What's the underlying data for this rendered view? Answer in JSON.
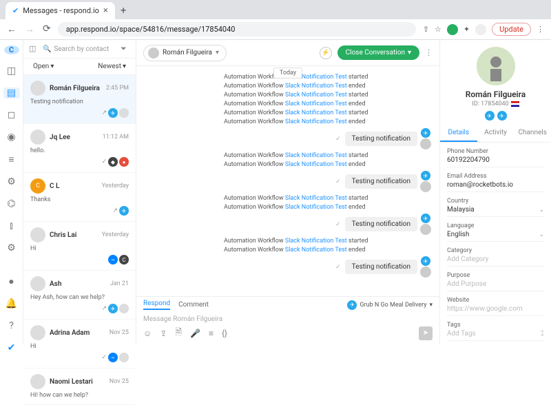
{
  "browser": {
    "tab_title": "Messages - respond.io",
    "url": "app.respond.io/space/54816/message/17854040",
    "update_label": "Update"
  },
  "rail": {
    "avatar_letter": "C"
  },
  "convlist": {
    "search_placeholder": "Search by contact",
    "filter_open": "Open",
    "filter_sort": "Newest",
    "items": [
      {
        "name": "Román Filgueira",
        "msg": "Testing notification",
        "time": "2:45 PM"
      },
      {
        "name": "Jq Lee",
        "msg": "hello.",
        "time": "11:12 AM"
      },
      {
        "name": "C L",
        "msg": "Thanks",
        "time": "Yesterday"
      },
      {
        "name": "Chris Lai",
        "msg": "Hi",
        "time": "Yesterday"
      },
      {
        "name": "Ash",
        "msg": "Hey Ash, how can we help?",
        "time": "Jan 21"
      },
      {
        "name": "Adrina Adam",
        "msg": "Hi",
        "time": "Nov 25"
      },
      {
        "name": "Naomi Lestari",
        "msg": "Hi! how can we help?",
        "time": "Nov 25"
      }
    ]
  },
  "header": {
    "assignee": "Román Filgueira",
    "close_label": "Close Conversation"
  },
  "messages": {
    "today_label": "Today",
    "log_prefix": "Automation Workflow ",
    "log_link": "Slack Notification Test",
    "started": " started",
    "ended": " ended",
    "bubble": "Testing notification"
  },
  "composer": {
    "tab_respond": "Respond",
    "tab_comment": "Comment",
    "channel_label": "Grub N Go Meal Delivery",
    "placeholder": "Message Román Filgueira"
  },
  "profile": {
    "name": "Román Filgueira",
    "id_label": "ID: 17854040",
    "tabs": {
      "details": "Details",
      "activity": "Activity",
      "channels": "Channels"
    },
    "fields": {
      "phone_l": "Phone Number",
      "phone_v": "60192204790",
      "email_l": "Email Address",
      "email_v": "roman@rocketbots.io",
      "country_l": "Country",
      "country_v": "Malaysia",
      "lang_l": "Language",
      "lang_v": "English",
      "cat_l": "Category",
      "cat_ph": "Add Category",
      "purpose_l": "Purpose",
      "purpose_ph": "Add Purpose",
      "web_l": "Website",
      "web_ph": "https://www.google.com",
      "tags_l": "Tags",
      "tags_ph": "Add Tags"
    }
  }
}
